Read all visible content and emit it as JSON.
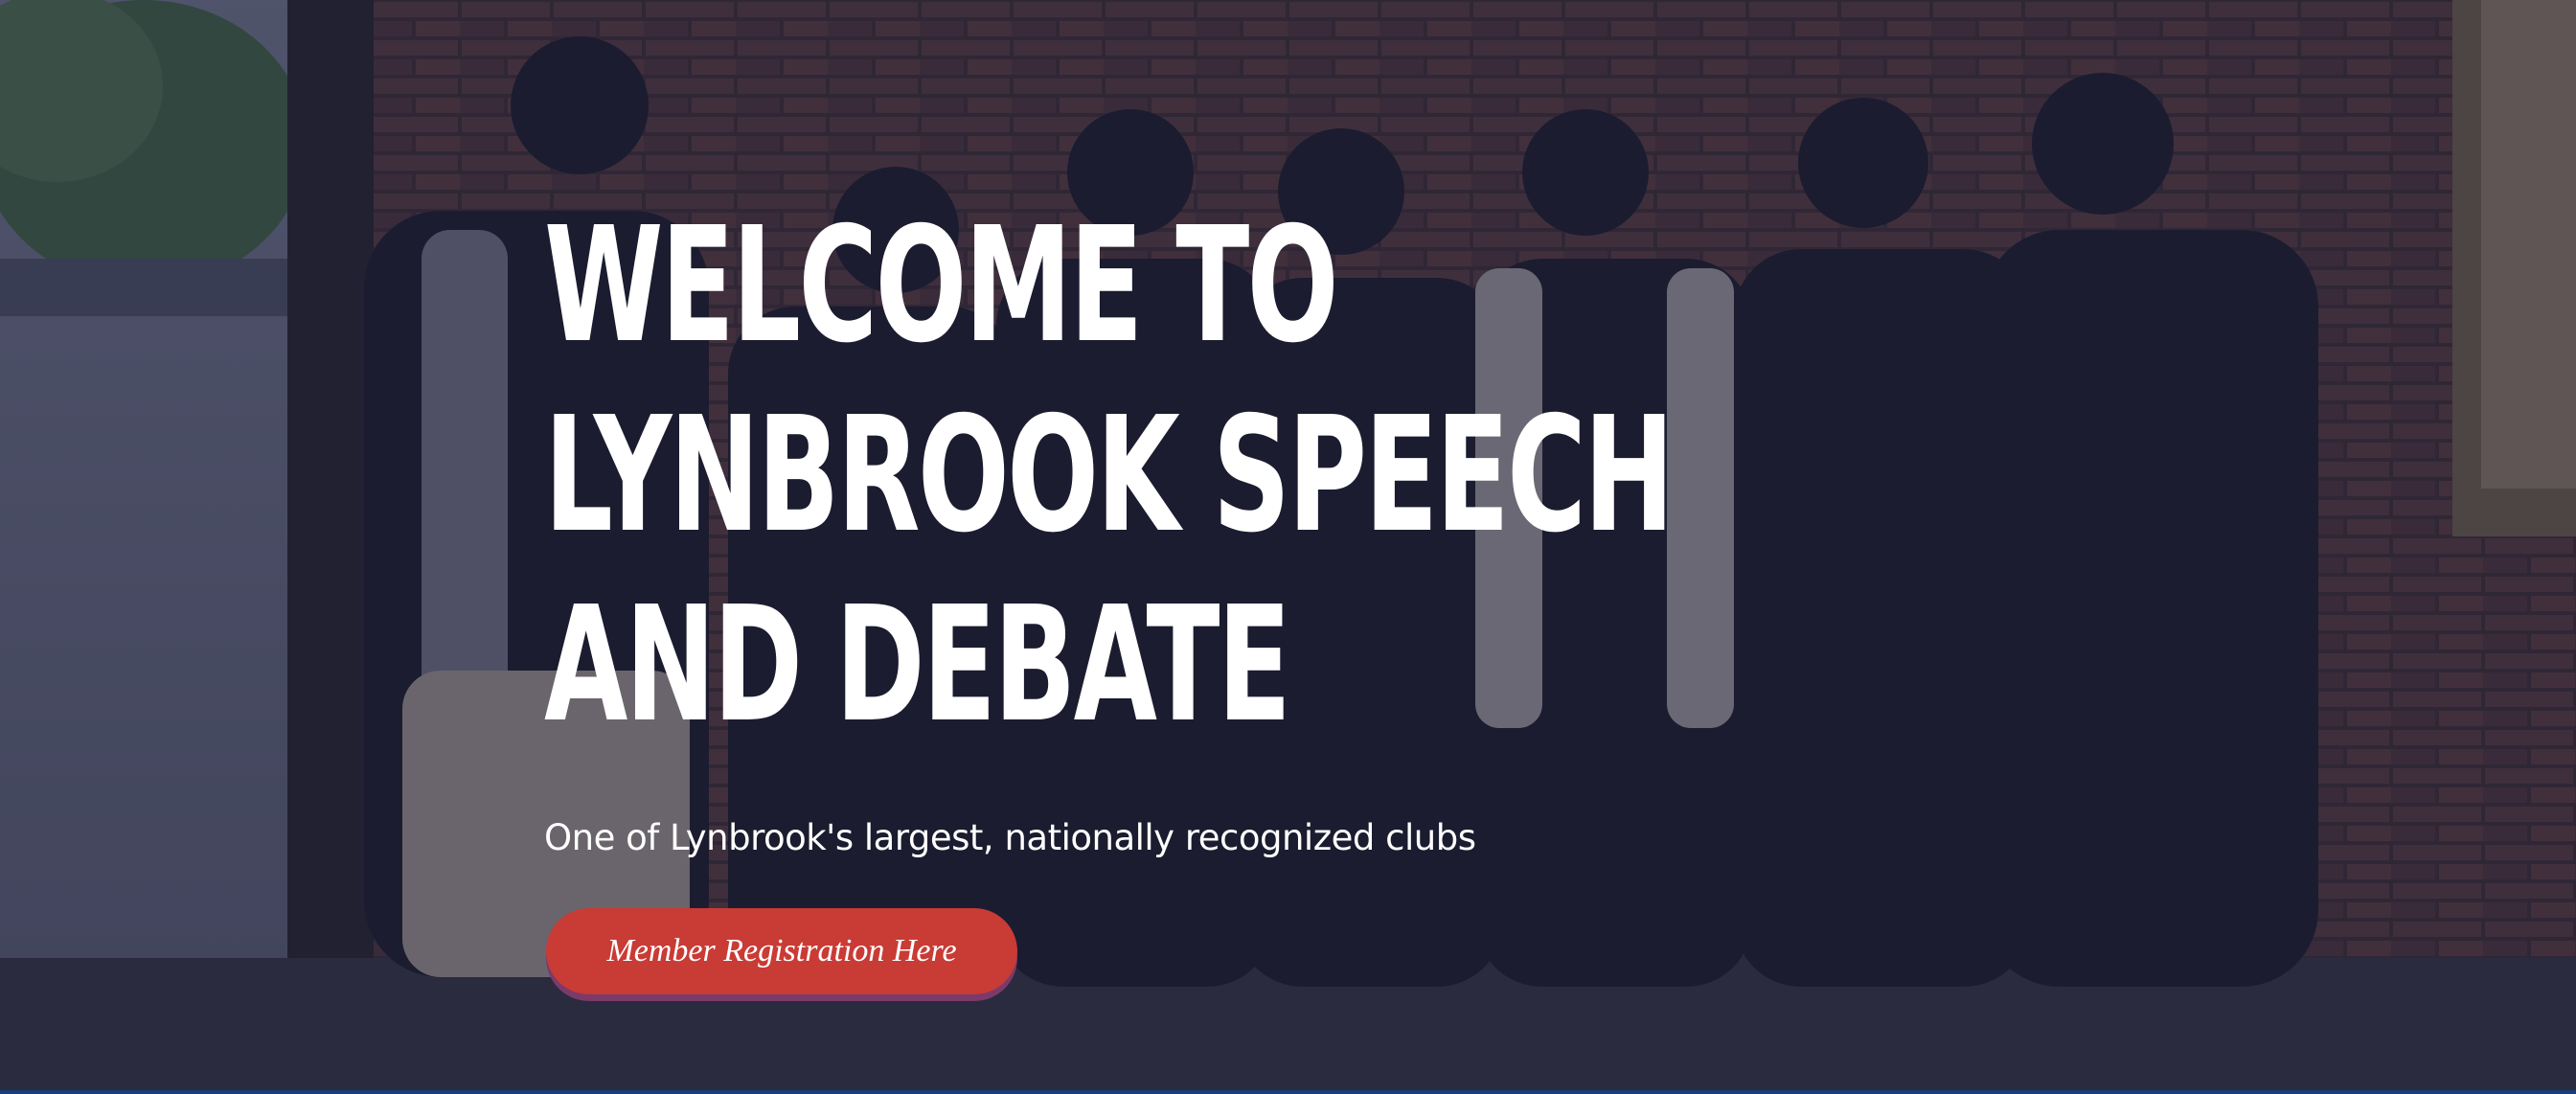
{
  "hero": {
    "title_lines": [
      "WELCOME TO",
      "LYNBROOK SPEECH",
      "AND DEBATE"
    ],
    "subtitle": "One of Lynbrook's largest, nationally recognized clubs",
    "cta_label": "Member Registration Here"
  },
  "colors": {
    "overlay": "#1c1e3a",
    "cta_background": "#c93b35",
    "cta_shadow": "#7b3a6a",
    "text": "#ffffff"
  }
}
